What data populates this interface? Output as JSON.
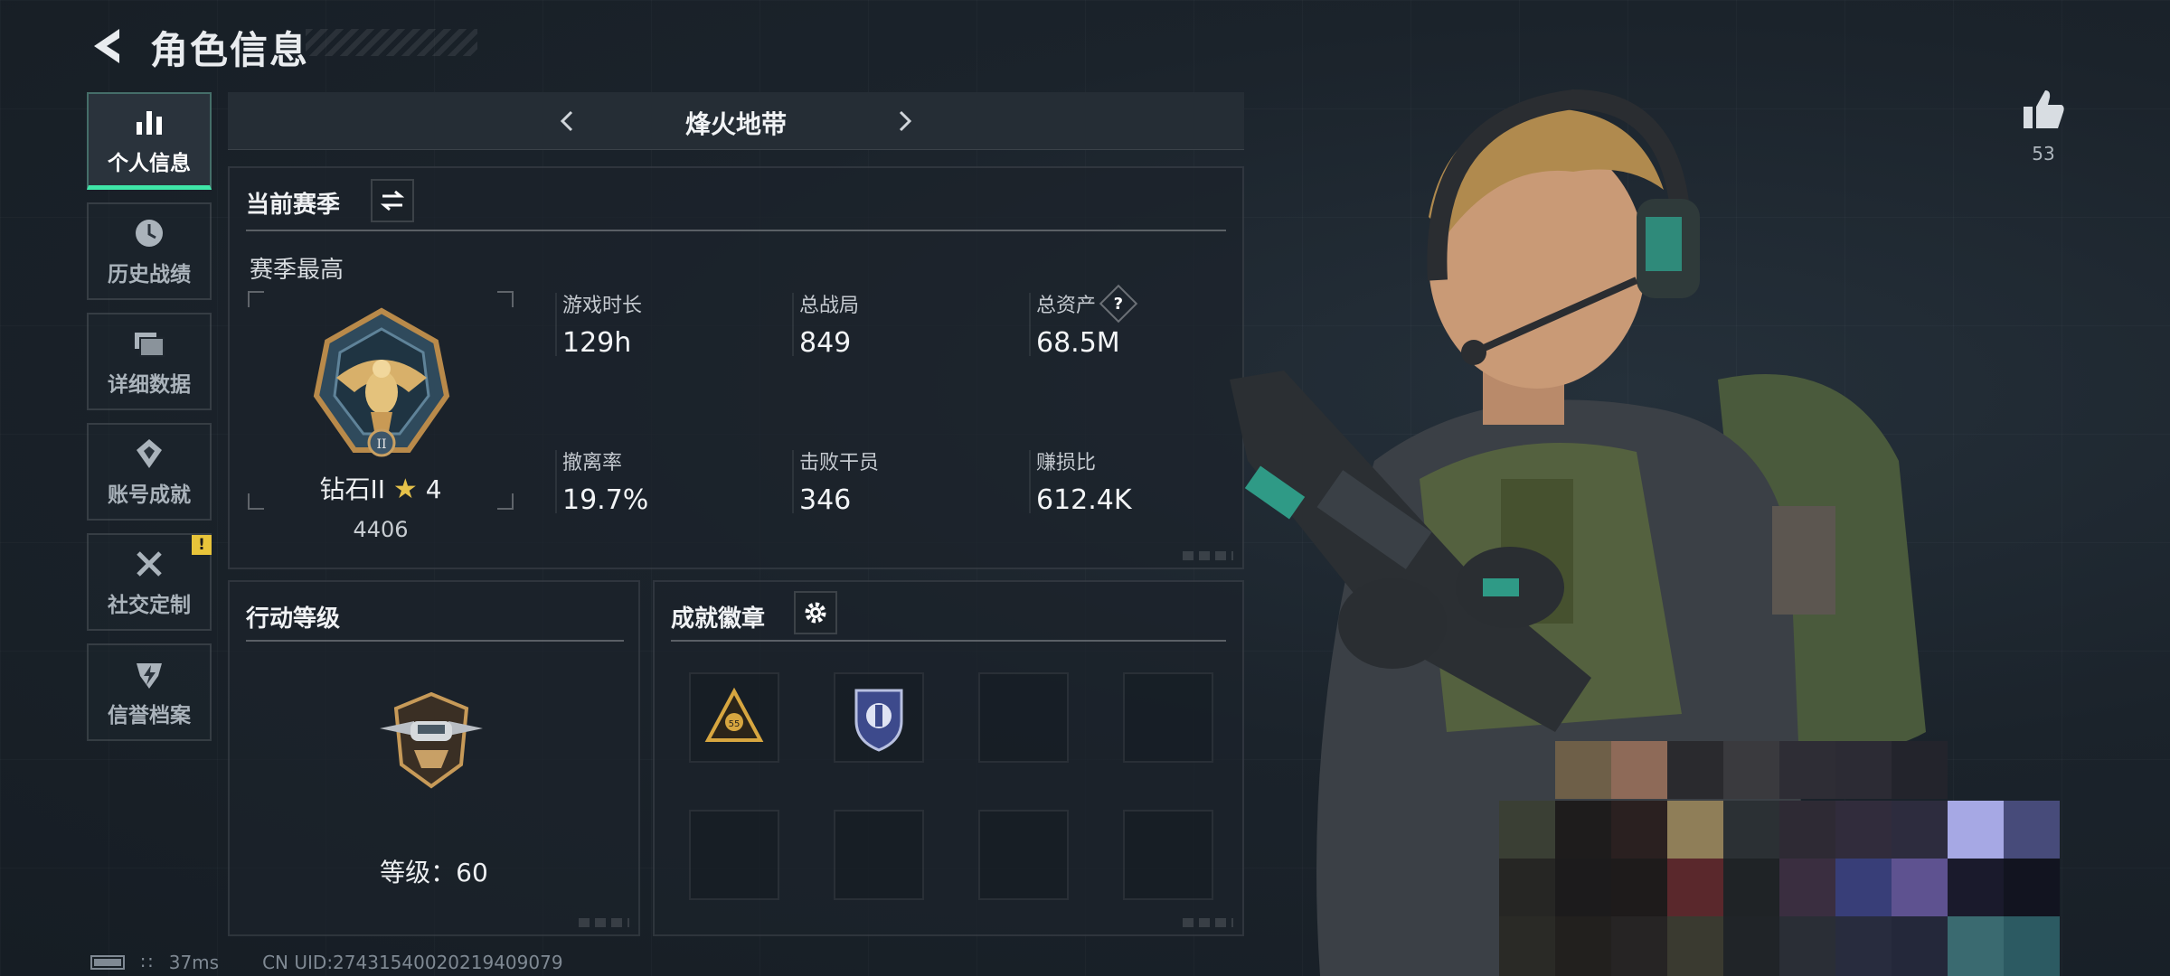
{
  "header": {
    "title": "角色信息"
  },
  "sidebar": {
    "items": [
      {
        "label": "个人信息",
        "icon": "bar-chart-icon",
        "active": true
      },
      {
        "label": "历史战绩",
        "icon": "history-clock-icon"
      },
      {
        "label": "详细数据",
        "icon": "folder-stack-icon"
      },
      {
        "label": "账号成就",
        "icon": "achievement-icon"
      },
      {
        "label": "社交定制",
        "icon": "tools-icon",
        "badge": "!"
      },
      {
        "label": "信誉档案",
        "icon": "reputation-icon"
      }
    ]
  },
  "mode": {
    "title": "烽火地带"
  },
  "season": {
    "title": "当前赛季",
    "subtitle": "赛季最高",
    "rank_name": "钻石II",
    "rank_stars": "4",
    "rank_score": "4406",
    "stats": [
      {
        "label": "游戏时长",
        "value": "129h"
      },
      {
        "label": "总战局",
        "value": "849"
      },
      {
        "label": "总资产",
        "value": "68.5M",
        "help": "?"
      },
      {
        "label": "撤离率",
        "value": "19.7%"
      },
      {
        "label": "击败干员",
        "value": "346"
      },
      {
        "label": "赚损比",
        "value": "612.4K"
      }
    ]
  },
  "level": {
    "title": "行动等级",
    "label": "等级：60"
  },
  "badges": {
    "title": "成就徽章"
  },
  "footer": {
    "ping": "37ms",
    "uid": "CN UID:27431540020219409079"
  },
  "likes": {
    "count": "53"
  },
  "colors": {
    "accent": "#3fe6a8",
    "gold": "#e6c24a",
    "warning": "#e8c43a"
  }
}
